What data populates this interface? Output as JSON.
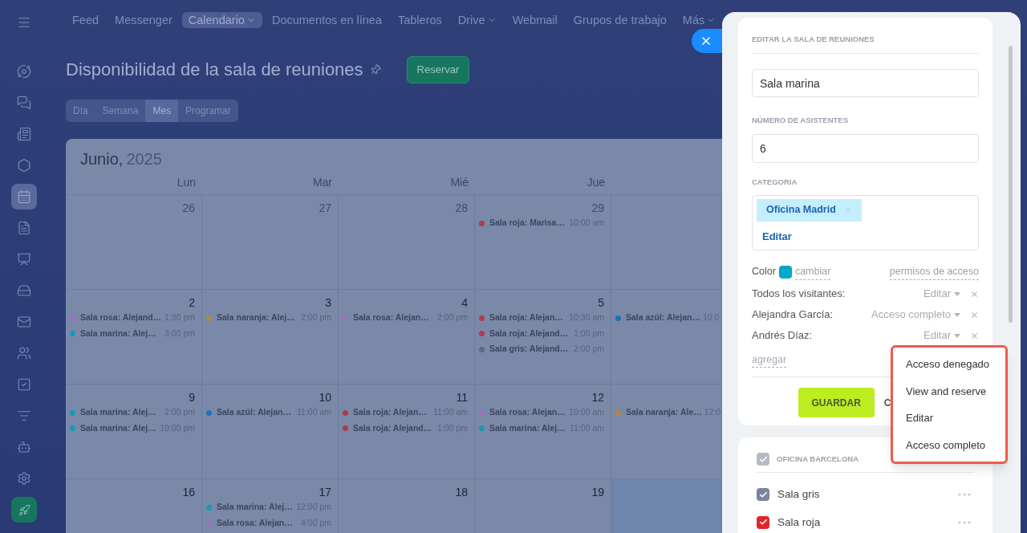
{
  "sidebar": {
    "items": [
      {
        "kind": "menu",
        "selected": false
      },
      {
        "kind": "orbit",
        "selected": false
      },
      {
        "kind": "chat",
        "selected": false
      },
      {
        "kind": "news",
        "selected": false
      },
      {
        "kind": "hexagon",
        "selected": false
      },
      {
        "kind": "calendar",
        "selected": true
      },
      {
        "kind": "file",
        "selected": false
      },
      {
        "kind": "presentation",
        "selected": false
      },
      {
        "kind": "drive",
        "selected": false
      },
      {
        "kind": "mail",
        "selected": false
      },
      {
        "kind": "users",
        "selected": false
      },
      {
        "kind": "task",
        "selected": false
      },
      {
        "kind": "funnel",
        "selected": false
      },
      {
        "kind": "bot",
        "selected": false
      },
      {
        "kind": "settings",
        "selected": false
      },
      {
        "kind": "rocket",
        "selected": false
      }
    ]
  },
  "top_nav": {
    "items": [
      {
        "label": "Feed",
        "selected": false,
        "dropdown": false
      },
      {
        "label": "Messenger",
        "selected": false,
        "dropdown": false
      },
      {
        "label": "Calendario",
        "selected": true,
        "dropdown": true
      },
      {
        "label": "Documentos en línea",
        "selected": false,
        "dropdown": false
      },
      {
        "label": "Tableros",
        "selected": false,
        "dropdown": false
      },
      {
        "label": "Drive",
        "selected": false,
        "dropdown": true
      },
      {
        "label": "Webmail",
        "selected": false,
        "dropdown": false
      },
      {
        "label": "Grupos de trabajo",
        "selected": false,
        "dropdown": false
      },
      {
        "label": "Más",
        "selected": false,
        "dropdown": true
      }
    ]
  },
  "page": {
    "title": "Disponibilidad de la sala de reuniones",
    "reserve_button": "Reservar",
    "view_tabs": [
      {
        "label": "Día",
        "selected": false
      },
      {
        "label": "Semana",
        "selected": false
      },
      {
        "label": "Mes",
        "selected": true
      },
      {
        "label": "Programar",
        "selected": false
      }
    ]
  },
  "calendar": {
    "month": "Junio,",
    "year": "2025",
    "weekdays": [
      "Lun",
      "Mar",
      "Mié",
      "Jue"
    ],
    "weeks": [
      [
        {
          "day": "26",
          "other_month": true,
          "highlighted": false
        },
        {
          "day": "27",
          "other_month": true,
          "highlighted": false
        },
        {
          "day": "28",
          "other_month": true,
          "highlighted": false
        },
        {
          "day": "29",
          "other_month": true,
          "highlighted": false,
          "events": [
            {
              "title": "Sala roja: Marisa…",
              "time": "10:00 am",
              "color": "#b03a4c"
            }
          ]
        },
        {
          "highlighted": false
        }
      ],
      [
        {
          "day": "2",
          "other_month": false,
          "highlighted": false,
          "events": [
            {
              "title": "Sala rosa: Alejand…",
              "time": "1:30 pm",
              "color": "#9a72c0"
            },
            {
              "title": "Sala marina: Alej…",
              "time": "3:00 pm",
              "color": "#1a97b3"
            }
          ]
        },
        {
          "day": "3",
          "other_month": false,
          "highlighted": false,
          "events": [
            {
              "title": "Sala naranja: Alej…",
              "time": "2:00 pm",
              "color": "#ad8945"
            }
          ]
        },
        {
          "day": "4",
          "other_month": false,
          "highlighted": false,
          "events": [
            {
              "title": "Sala rosa: Alejan…",
              "time": "2:00 pm",
              "color": "#9a72c0"
            }
          ]
        },
        {
          "day": "5",
          "other_month": false,
          "highlighted": false,
          "events": [
            {
              "title": "Sala roja: Alejan…",
              "time": "10:30 am",
              "color": "#b03a4c"
            },
            {
              "title": "Sala roja: Alejand…",
              "time": "1:00 pm",
              "color": "#b03a4c"
            },
            {
              "title": "Sala gris: Alejand…",
              "time": "2:00 pm",
              "color": "#5b6a88"
            }
          ]
        },
        {
          "highlighted": false,
          "events": [
            {
              "title": "Sala azúl: Alejan…",
              "time": "10:0",
              "color": "#1873bd"
            }
          ]
        }
      ],
      [
        {
          "day": "9",
          "other_month": false,
          "highlighted": false,
          "events": [
            {
              "title": "Sala marina: Alej…",
              "time": "2:00 pm",
              "color": "#1a97b3"
            },
            {
              "title": "Sala marina: Alej…",
              "time": "10:00 pm",
              "color": "#1a97b3"
            }
          ]
        },
        {
          "day": "10",
          "other_month": false,
          "highlighted": false,
          "events": [
            {
              "title": "Sala azúl: Alejan…",
              "time": "11:00 am",
              "color": "#1873bd"
            }
          ]
        },
        {
          "day": "11",
          "other_month": false,
          "highlighted": false,
          "events": [
            {
              "title": "Sala roja: Alejan…",
              "time": "11:00 am",
              "color": "#b03a4c"
            },
            {
              "title": "Sala roja: Alejand…",
              "time": "1:00 pm",
              "color": "#b03a4c"
            }
          ]
        },
        {
          "day": "12",
          "other_month": false,
          "highlighted": false,
          "events": [
            {
              "title": "Sala rosa: Alejan…",
              "time": "10:00 am",
              "color": "#9a72c0"
            },
            {
              "title": "Sala marina: Alej…",
              "time": "11:00 am",
              "color": "#1a97b3"
            }
          ]
        },
        {
          "highlighted": false,
          "events": [
            {
              "title": "Sala naranja: Ale…",
              "time": "12:0",
              "color": "#ad8945"
            }
          ]
        }
      ],
      [
        {
          "day": "16",
          "other_month": false,
          "highlighted": false
        },
        {
          "day": "17",
          "other_month": false,
          "highlighted": false,
          "events": [
            {
              "title": "Sala marina: Alej…",
              "time": "12:00 pm",
              "color": "#1a97b3"
            },
            {
              "title": "Sala rosa: Alejan…",
              "time": "4:00 pm",
              "color": "#9a72c0"
            }
          ]
        },
        {
          "day": "18",
          "other_month": false,
          "highlighted": false
        },
        {
          "day": "19",
          "other_month": false,
          "highlighted": false
        },
        {
          "highlighted": true
        }
      ]
    ]
  },
  "edit_panel": {
    "heading": "EDITAR LA SALA DE REUNIONES",
    "name_value": "Sala marina",
    "attendees_label": "NÚMERO DE ASISTENTES",
    "attendees_value": "6",
    "category_label": "CATEGORIA",
    "category_tags": [
      "Oficina Madrid"
    ],
    "category_edit": "Editar",
    "color_label": "Color",
    "color": "#00a9c7",
    "change_link": "cambiar",
    "permissions_link": "permisos de acceso",
    "permissions": [
      {
        "name": "Todos los visitantes:",
        "level": "Editar"
      },
      {
        "name": "Alejandra García:",
        "level": "Acceso completo"
      },
      {
        "name": "Andrés Díaz:",
        "level": "Editar"
      }
    ],
    "add_link": "agregar",
    "save_button": "GUARDAR",
    "cancel_button": "C",
    "access_menu": [
      "Acceso denegado",
      "View and reserve",
      "Editar",
      "Acceso completo"
    ]
  },
  "rooms_panel": {
    "group": {
      "label": "OFICINA BARCELONA",
      "checked": true
    },
    "rooms": [
      {
        "name": "Sala gris",
        "checked": true,
        "color": "#7b84a0"
      },
      {
        "name": "Sala roja",
        "checked": true,
        "color": "#e0262c"
      }
    ]
  }
}
